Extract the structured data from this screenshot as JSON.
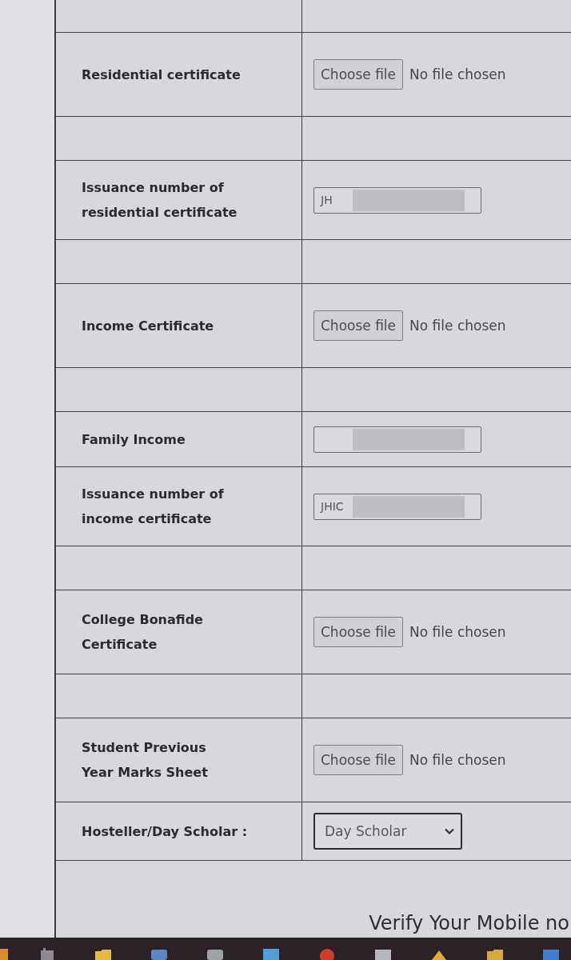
{
  "form": {
    "rows": [
      {
        "kind": "spacer"
      },
      {
        "kind": "file",
        "label": "Residential certificate",
        "button": "Choose file",
        "status": "No file chosen"
      },
      {
        "kind": "spacer"
      },
      {
        "kind": "text",
        "label": "Issuance number of\nresidential certificate",
        "value": "JH",
        "redacted": true
      },
      {
        "kind": "spacer"
      },
      {
        "kind": "file",
        "label": "Income Certificate",
        "button": "Choose file",
        "status": "No file chosen"
      },
      {
        "kind": "spacer"
      },
      {
        "kind": "text",
        "label": "Family Income",
        "redacted": true
      },
      {
        "kind": "text",
        "label": "Issuance number of\nincome certificate",
        "value": "JHIC",
        "redacted": true
      },
      {
        "kind": "spacer"
      },
      {
        "kind": "file",
        "label": "College Bonafide\nCertificate",
        "button": "Choose file",
        "status": "No file chosen"
      },
      {
        "kind": "spacer"
      },
      {
        "kind": "file",
        "label": "Student Previous\nYear Marks Sheet",
        "button": "Choose file",
        "status": "No file chosen"
      },
      {
        "kind": "select",
        "label": "Hosteller/Day Scholar :",
        "value": "Day Scholar"
      }
    ]
  },
  "footer": {
    "heading": "Verify Your Mobile no"
  }
}
